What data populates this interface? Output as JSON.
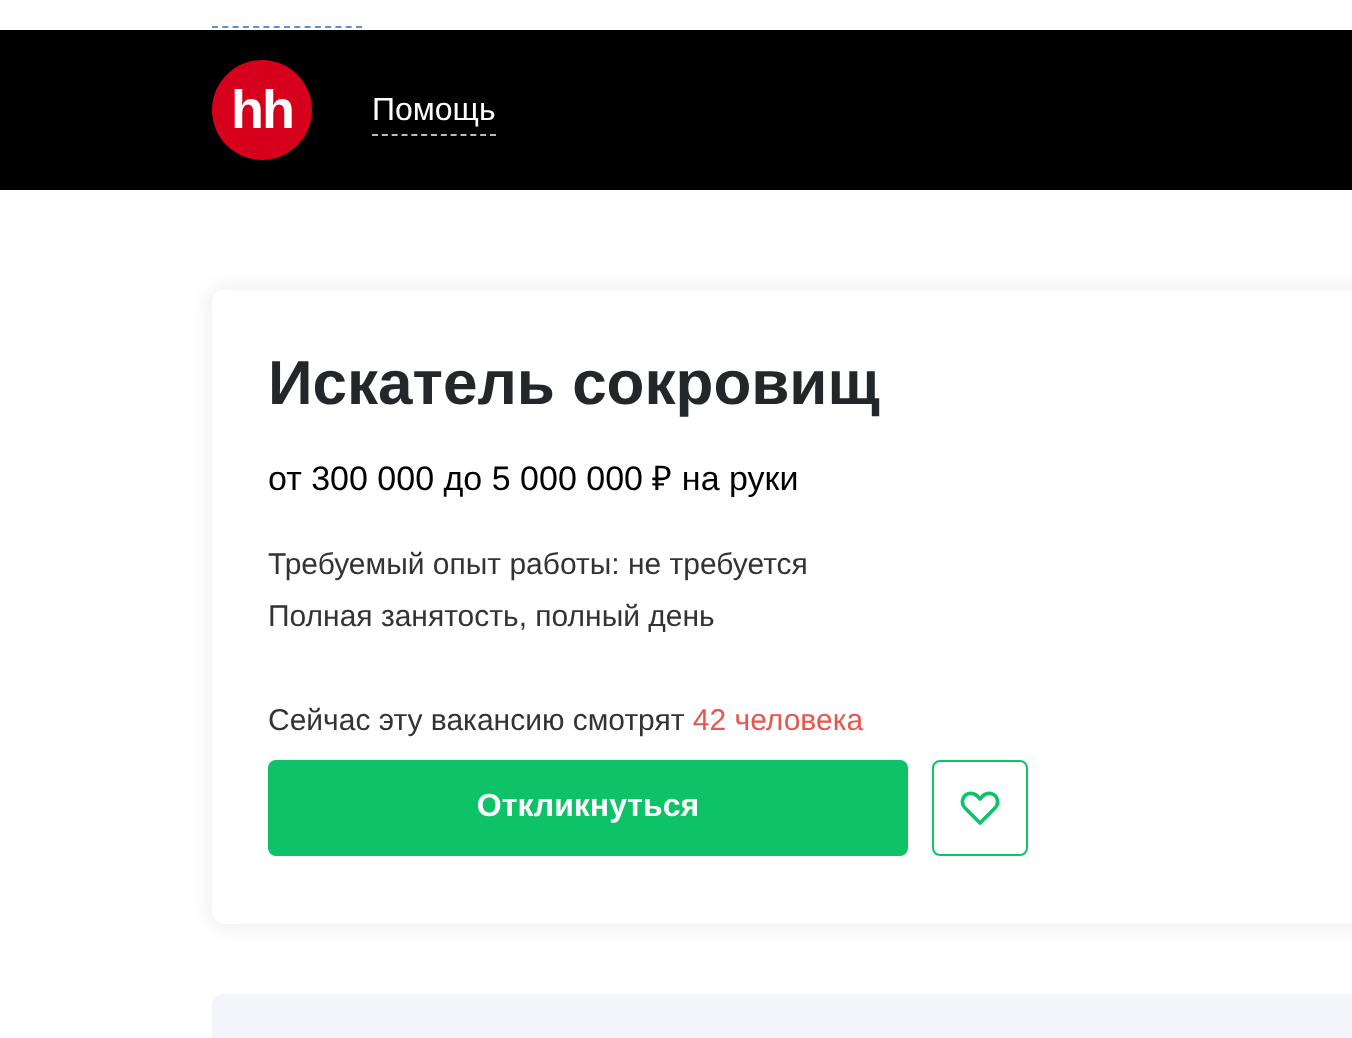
{
  "header": {
    "logo": "hh",
    "nav_link": "Помощь"
  },
  "vacancy": {
    "title": "Искатель сокровищ",
    "salary": "от 300 000 до 5 000 000 ₽ на руки",
    "details": [
      "Требуемый опыт работы: не требуется",
      "Полная занятость, полный день"
    ],
    "viewers": {
      "text": "Сейчас эту вакансию смотрят",
      "count": "42 человека"
    },
    "respond_button": "Откликнуться"
  }
}
